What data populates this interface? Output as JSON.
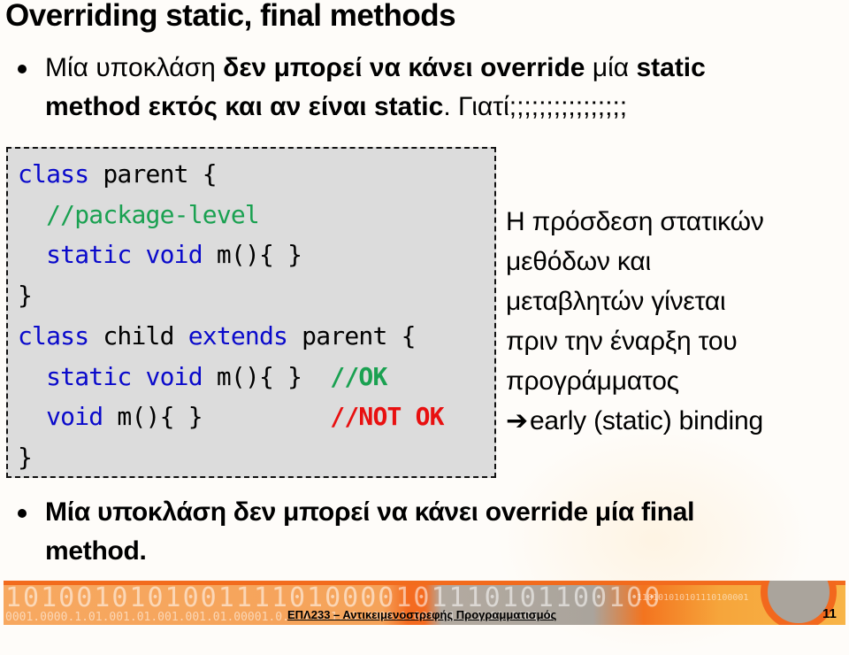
{
  "slide": {
    "title": "Overriding static, final methods",
    "bullet1": {
      "line1": [
        {
          "text": "Μία υποκλάση ",
          "bold": false
        },
        {
          "text": "δεν μπορεί να κάνει override ",
          "bold": true
        },
        {
          "text": "μία ",
          "bold": false
        },
        {
          "text": "static",
          "bold": true
        }
      ],
      "line2": [
        {
          "text": "method εκτός και αν είναι static",
          "bold": true
        },
        {
          "text": ". Γιατί;;;;;;;;;;;;;;;;",
          "bold": false
        }
      ]
    },
    "code_box": {
      "lines": [
        {
          "indent": "",
          "tokens": [
            {
              "t": "class",
              "c": "kw"
            },
            {
              "t": " parent {",
              "c": "tx"
            }
          ]
        },
        {
          "indent": "  ",
          "tokens": [
            {
              "t": "//package-level",
              "c": "cm-green"
            }
          ]
        },
        {
          "indent": "  ",
          "tokens": [
            {
              "t": "static void",
              "c": "kw"
            },
            {
              "t": " m(){ }",
              "c": "tx"
            }
          ]
        },
        {
          "indent": "",
          "tokens": [
            {
              "t": "}",
              "c": "tx"
            }
          ]
        },
        {
          "indent": "",
          "tokens": [
            {
              "t": "class",
              "c": "kw"
            },
            {
              "t": " child ",
              "c": "tx"
            },
            {
              "t": "extends",
              "c": "kw"
            },
            {
              "t": " parent {",
              "c": "tx"
            }
          ]
        },
        {
          "indent": "  ",
          "tokens": [
            {
              "t": "static void",
              "c": "kw"
            },
            {
              "t": " m(){ }  ",
              "c": "tx"
            },
            {
              "t": "//OK",
              "c": "cm-ok"
            }
          ]
        },
        {
          "indent": "  ",
          "tokens": [
            {
              "t": "void",
              "c": "kw"
            },
            {
              "t": " m(){ }         ",
              "c": "tx"
            },
            {
              "t": "//NOT OK",
              "c": "cm-red"
            }
          ]
        },
        {
          "indent": "",
          "tokens": [
            {
              "t": "}",
              "c": "tx"
            }
          ]
        }
      ]
    },
    "note": {
      "lines": [
        "Η πρόσδεση στατικών",
        "μεθόδων και",
        "μεταβλητών γίνεται",
        "πριν την έναρξη του",
        "προγράμματος"
      ],
      "arrow_icon": "➔",
      "conclusion": "early (static) binding"
    },
    "bullet2": {
      "line1": "Μία υποκλάση δεν μπορεί να κάνει override μία final",
      "line2": "method."
    }
  },
  "footer": {
    "course": "ΕΠΛ233 – Αντικειμενοστρεφής Προγραμματισμός",
    "page_number": "11",
    "binary_big": "1010010101001111010000101110101100100",
    "binary_small": "0001.0000.1.01.001.01.001.001.01.00001.0.1.1.0.1.01.0000.1.001.01.1.1.01.0001.0",
    "binary_right": "110101010101110100001",
    "colors": {
      "accent_orange": "#f26b1d",
      "keyword_blue": "#0a0acb",
      "comment_green": "#1aa151",
      "error_red": "#e81010",
      "code_bg": "#dcdcdc"
    }
  }
}
